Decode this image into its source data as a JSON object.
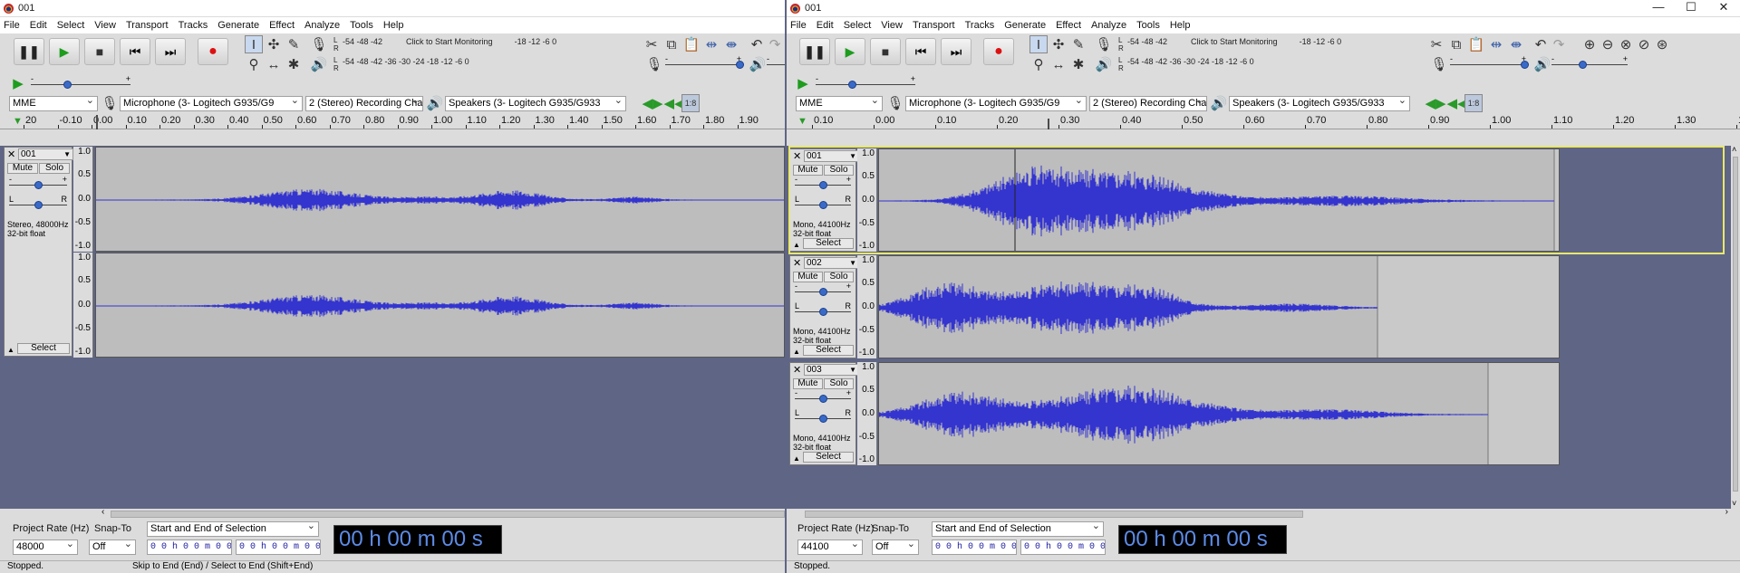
{
  "menu": [
    "File",
    "Edit",
    "Select",
    "View",
    "Transport",
    "Tracks",
    "Generate",
    "Effect",
    "Analyze",
    "Tools",
    "Help"
  ],
  "meter_scale": "-54   -48   -42",
  "meter_scale2": "-18   -12    -6     0",
  "meter_scale_play": "-54   -48   -42   -36   -30   -24   -18   -12    -6     0",
  "monitor_hint": "Click to Start Monitoring",
  "left": {
    "title": "001",
    "host": "MME",
    "mic": "Microphone (3- Logitech G935/G9",
    "channels": "2 (Stereo) Recording Chann",
    "speaker": "Speakers (3- Logitech G935/G933",
    "ruler": [
      "20",
      "-0.10",
      "0.00",
      "0.10",
      "0.20",
      "0.30",
      "0.40",
      "0.50",
      "0.60",
      "0.70",
      "0.80",
      "0.90",
      "1.00",
      "1.10",
      "1.20",
      "1.30",
      "1.40",
      "1.50",
      "1.60",
      "1.70",
      "1.80",
      "1.90"
    ],
    "track": {
      "name": "001",
      "mute": "Mute",
      "solo": "Solo",
      "info1": "Stereo, 48000Hz",
      "info2": "32-bit float",
      "select": "Select"
    },
    "project_rate_label": "Project Rate (Hz)",
    "snap_label": "Snap-To",
    "selection_label": "Start and End of Selection",
    "rate": "48000",
    "snap": "Off",
    "time1": "0 0 h 0 0 m 0 0 s",
    "time2": "0 0 h 0 0 m 0 0 s",
    "bigtime": "00 h 00 m 00 s",
    "status": "Stopped.",
    "status2": "Skip to End (End) / Select to End (Shift+End)"
  },
  "right": {
    "title": "001",
    "host": "MME",
    "mic": "Microphone (3- Logitech G935/G9",
    "channels": "2 (Stereo) Recording Chann",
    "speaker": "Speakers (3- Logitech G935/G933",
    "ruler": [
      "0.10",
      "0.00",
      "0.10",
      "0.20",
      "0.30",
      "0.40",
      "0.50",
      "0.60",
      "0.70",
      "0.80",
      "0.90",
      "1.00",
      "1.10",
      "1.20",
      "1.30",
      "1.40"
    ],
    "tracks": [
      {
        "name": "001",
        "mute": "Mute",
        "solo": "Solo",
        "info1": "Mono, 44100Hz",
        "info2": "32-bit float",
        "select": "Select"
      },
      {
        "name": "002",
        "mute": "Mute",
        "solo": "Solo",
        "info1": "Mono, 44100Hz",
        "info2": "32-bit float",
        "select": "Select"
      },
      {
        "name": "003",
        "mute": "Mute",
        "solo": "Solo",
        "info1": "Mono, 44100Hz",
        "info2": "32-bit float",
        "select": "Select"
      }
    ],
    "project_rate_label": "Project Rate (Hz)",
    "snap_label": "Snap-To",
    "selection_label": "Start and End of Selection",
    "rate": "44100",
    "snap": "Off",
    "time1": "0 0 h 0 0 m 0 0 s",
    "time2": "0 0 h 0 0 m 0 0 s",
    "bigtime": "00 h 00 m 00 s",
    "status": "Stopped."
  },
  "scale_labels": [
    "1.0",
    "0.5",
    "0.0",
    "-0.5",
    "-1.0"
  ],
  "pan_l": "L",
  "pan_r": "R",
  "gain_min": "-",
  "gain_max": "+",
  "window_controls": [
    "—",
    "☐",
    "✕"
  ]
}
